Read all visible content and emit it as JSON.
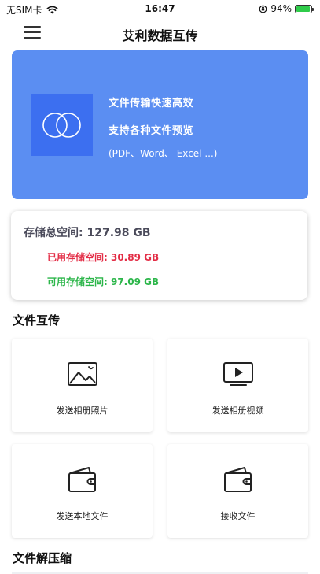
{
  "status_bar": {
    "carrier": "无SIM卡",
    "time": "16:47",
    "battery": "94%"
  },
  "nav": {
    "title": "艾利数据互传"
  },
  "banner": {
    "line1": "文件传输快速高效",
    "line2": "支持各种文件预览",
    "line3": "(PDF、Word、 Excel ...)"
  },
  "storage": {
    "total": "存储总空间: 127.98 GB",
    "used": "已用存储空间: 30.89 GB",
    "free": "可用存储空间: 97.09 GB"
  },
  "sections": {
    "transfer": "文件互传",
    "decompress": "文件解压缩"
  },
  "tiles": [
    {
      "label": "发送相册照片",
      "icon": "photo-icon"
    },
    {
      "label": "发送相册视频",
      "icon": "video-icon"
    },
    {
      "label": "发送本地文件",
      "icon": "wallet-icon"
    },
    {
      "label": "接收文件",
      "icon": "wallet-icon"
    }
  ],
  "colors": {
    "banner": "#5b8ef2",
    "banner_logo": "#3c6ff0",
    "used": "#e32d46",
    "free": "#2cb64a"
  }
}
